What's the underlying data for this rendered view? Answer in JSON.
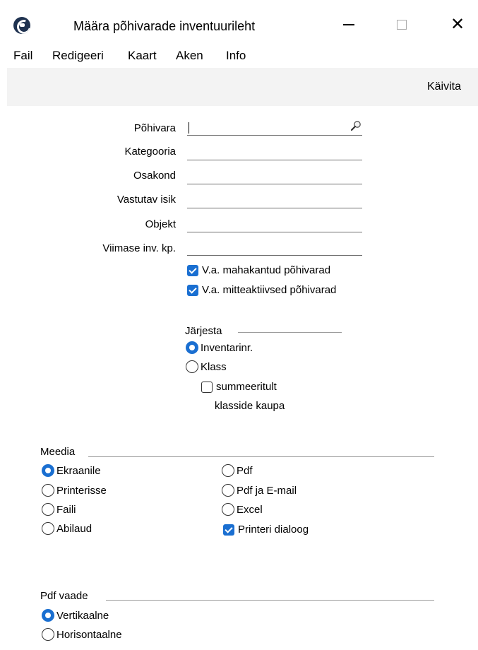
{
  "window": {
    "title": "Määra põhivarade inventuurileht",
    "app_icon": "app-logo-icon",
    "minimize_icon": "minimize-icon",
    "maximize_icon": "maximize-icon",
    "close_glyph": "✕"
  },
  "menu": [
    "Fail",
    "Redigeeri",
    "Kaart",
    "Aken",
    "Info"
  ],
  "toolbar": {
    "run_label": "Käivita"
  },
  "fields": [
    {
      "label": "Põhivara",
      "value": ""
    },
    {
      "label": "Kategooria",
      "value": ""
    },
    {
      "label": "Osakond",
      "value": ""
    },
    {
      "label": "Vastutav isik",
      "value": ""
    },
    {
      "label": "Objekt",
      "value": ""
    },
    {
      "label": "Viimase inv. kp.",
      "value": ""
    }
  ],
  "options": [
    {
      "label": "V.a. mahakantud põhivarad",
      "checked": true
    },
    {
      "label": "V.a. mitteaktiivsed põhivarad",
      "checked": true
    }
  ],
  "sort": {
    "title": "Järjesta",
    "choices": [
      {
        "label": "Inventarinr.",
        "selected": true
      },
      {
        "label": "Klass",
        "selected": false
      }
    ],
    "summary_label_line1": "summeeritult",
    "summary_label_line2": "klasside kaupa",
    "summary_checked": false
  },
  "media": {
    "title": "Meedia",
    "left": [
      {
        "label": "Ekraanile",
        "selected": true
      },
      {
        "label": "Printerisse",
        "selected": false
      },
      {
        "label": "Faili",
        "selected": false
      },
      {
        "label": "Abilaud",
        "selected": false
      }
    ],
    "right": [
      {
        "label": "Pdf",
        "selected": false
      },
      {
        "label": "Pdf ja E-mail",
        "selected": false
      },
      {
        "label": "Excel",
        "selected": false
      }
    ],
    "printer_dialog_label": "Printeri dialoog",
    "printer_dialog_checked": true
  },
  "pdf_view": {
    "title": "Pdf vaade",
    "choices": [
      {
        "label": "Vertikaalne",
        "selected": true
      },
      {
        "label": "Horisontaalne",
        "selected": false
      }
    ]
  },
  "colors": {
    "accent": "#1a6fd1",
    "toolbar_bg": "#f3f3f3"
  }
}
